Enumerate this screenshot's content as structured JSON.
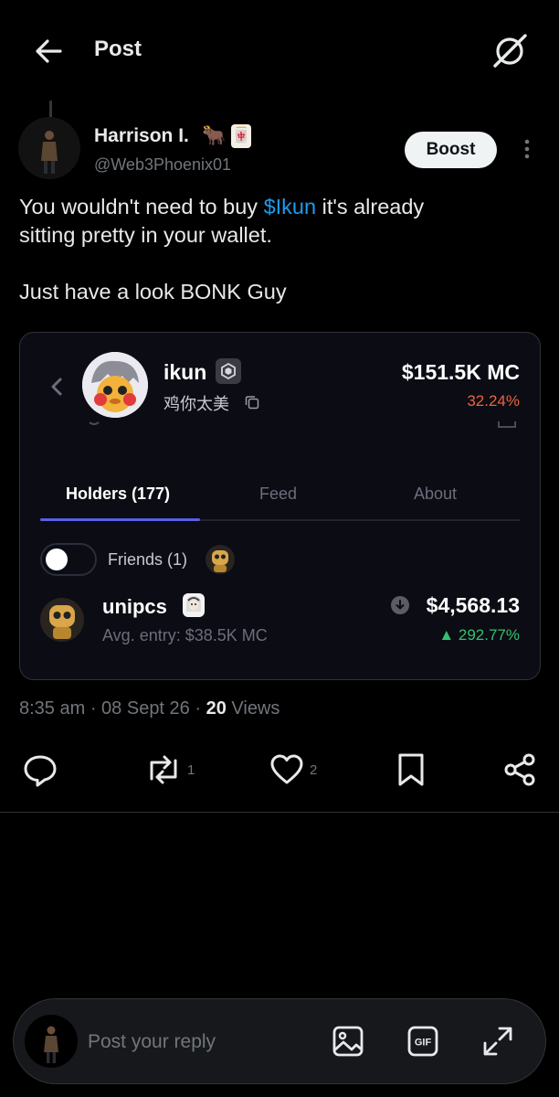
{
  "header": {
    "title": "Post"
  },
  "author": {
    "name": "Harrison I.",
    "handle": "@Web3Phoenix01",
    "emojis": [
      "🐂",
      "🀄"
    ]
  },
  "boost_label": "Boost",
  "post": {
    "lines": [
      {
        "before": "You wouldn't need to buy ",
        "cashtag": "$Ikun",
        "after": " it's already"
      },
      {
        "text": "sitting pretty in your wallet."
      },
      {
        "text": "Just have a look BONK Guy"
      }
    ]
  },
  "card": {
    "token_name": "ikun",
    "token_subtitle": "鸡你太美",
    "market_cap": "$151.5K MC",
    "market_cap_change": "32.24%",
    "tabs": [
      "Holders (177)",
      "Feed",
      "About"
    ],
    "active_tab": "Holders (177)",
    "friends_label": "Friends (1)",
    "friends_toggle_on": false,
    "holder": {
      "name": "unipcs",
      "avg_entry": "Avg. entry: $38.5K MC",
      "value": "$4,568.13",
      "change": "292.77%"
    }
  },
  "meta": {
    "time": "8:35 am",
    "date": "08 Sept 26",
    "views_count": "20",
    "views_label": "Views"
  },
  "actions": {
    "reply_count": "",
    "repost_count": "1",
    "like_count": "2"
  },
  "composer": {
    "placeholder": "Post your reply"
  },
  "colors": {
    "background": "#000000",
    "cashtag": "#1d9bf0",
    "negative": "#f0623e",
    "positive": "#32c26d",
    "tab_indicator": "#5960e6"
  },
  "icons": [
    "arrow-left-icon",
    "grok-icon",
    "more-vertical-icon",
    "chevron-left-icon",
    "token-badge-icon",
    "copy-icon",
    "download-icon",
    "reply-icon",
    "repost-icon",
    "like-icon",
    "bookmark-icon",
    "share-icon",
    "image-icon",
    "gif-icon",
    "expand-icon"
  ]
}
